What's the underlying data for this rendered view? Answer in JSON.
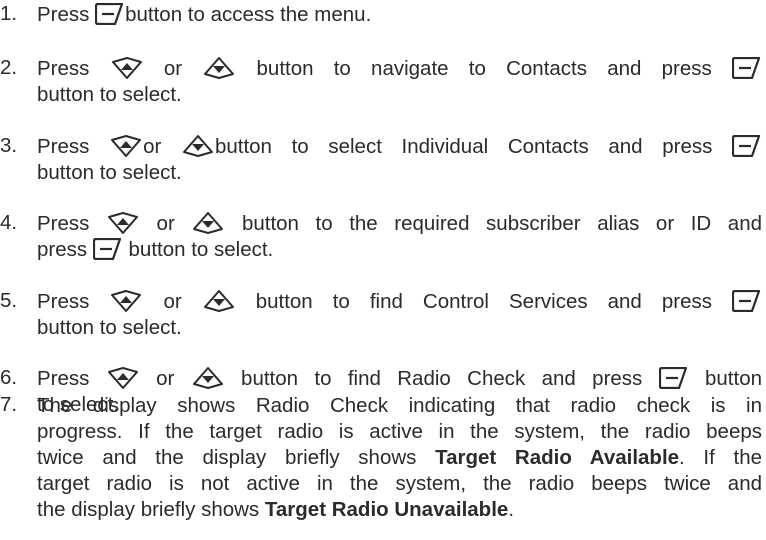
{
  "steps": [
    {
      "num": "1.",
      "lines": [
        [
          "Press ",
          "{menu}",
          "button to access the menu."
        ]
      ]
    },
    {
      "num": "2.",
      "lines": [
        [
          "Press ",
          "{up}",
          " or ",
          "{down}",
          "  button to navigate to Contacts and press ",
          "{menu}"
        ],
        [
          "button to select."
        ]
      ]
    },
    {
      "num": "3.",
      "lines": [
        [
          "Press ",
          "{up}",
          "or ",
          "{down}",
          "button to select Individual Contacts and press ",
          "{menu}"
        ],
        [
          "button to select."
        ]
      ]
    },
    {
      "num": "4.",
      "lines": [
        [
          "Press ",
          "{up}",
          " or ",
          "{down}",
          "  button to the required subscriber alias or ID and"
        ],
        [
          "press ",
          "{menu}",
          " button to select."
        ]
      ]
    },
    {
      "num": "5.",
      "lines": [
        [
          "Press ",
          "{up}",
          " or ",
          "{down}",
          " button to find Control Services and press ",
          "{menu}"
        ],
        [
          "button to select."
        ]
      ]
    },
    {
      "num": "6.",
      "lines": [
        [
          "Press ",
          "{up}",
          " or ",
          "{down}",
          " button to find Radio Check and press ",
          "{menu}",
          " button"
        ],
        [
          "to select."
        ]
      ]
    },
    {
      "num": "7.",
      "lines": [
        [
          "The display shows Radio Check indicating that radio check is in"
        ],
        [
          "progress. If the target radio is active in the system, the radio beeps"
        ],
        [
          "twice and the display briefly shows ",
          "**Target Radio Available",
          ". If the"
        ],
        [
          "target radio is not active in the system, the radio beeps twice and"
        ],
        [
          "the display briefly shows ",
          "**Target Radio Unavailable",
          "."
        ]
      ]
    }
  ],
  "icons": {
    "menu": "menu-ok-button-icon",
    "up": "up-navigation-button-icon",
    "down": "down-navigation-button-icon"
  },
  "colors": {
    "text": "#2b2b2b",
    "background": "#ffffff"
  }
}
